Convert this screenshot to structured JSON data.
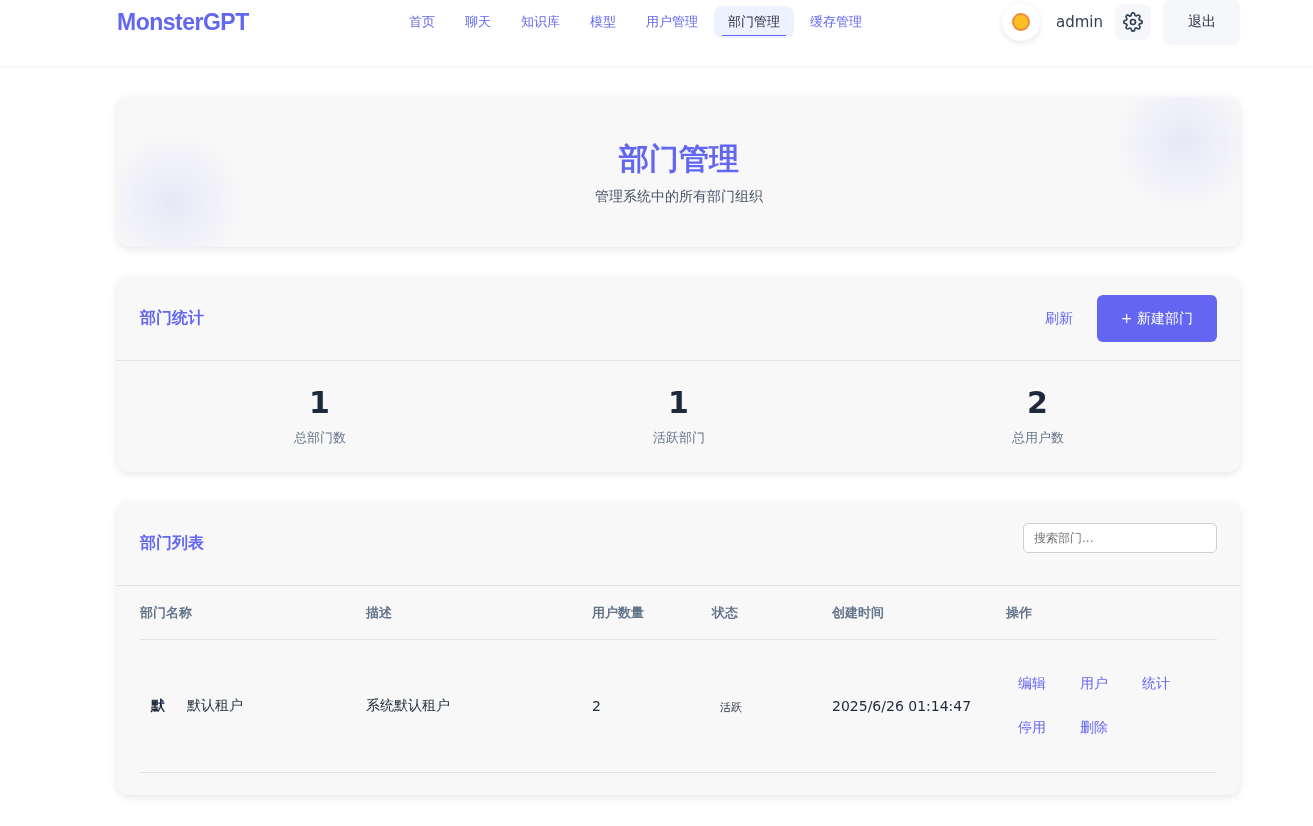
{
  "header": {
    "logo": "MonsterGPT",
    "nav": [
      {
        "label": "首页",
        "selected": false
      },
      {
        "label": "聊天",
        "selected": false
      },
      {
        "label": "知识库",
        "selected": false
      },
      {
        "label": "模型",
        "selected": false
      },
      {
        "label": "用户管理",
        "selected": false
      },
      {
        "label": "部门管理",
        "selected": true
      },
      {
        "label": "缓存管理",
        "selected": false
      }
    ],
    "user": "admin",
    "logout": "退出"
  },
  "hero": {
    "title": "部门管理",
    "subtitle": "管理系统中的所有部门组织"
  },
  "stats_card": {
    "title": "部门统计",
    "refresh": "刷新",
    "create": "+ 新建部门",
    "stats": [
      {
        "value": "1",
        "label": "总部门数"
      },
      {
        "value": "1",
        "label": "活跃部门"
      },
      {
        "value": "2",
        "label": "总用户数"
      }
    ]
  },
  "list_card": {
    "title": "部门列表",
    "search": {
      "placeholder": "搜索部门..."
    },
    "columns": [
      "部门名称",
      "描述",
      "用户数量",
      "状态",
      "创建时间",
      "操作"
    ],
    "rows": [
      {
        "avatar": "默",
        "name": "默认租户",
        "description": "系统默认租户",
        "users": "2",
        "status": "活跃",
        "created": "2025/6/26 01:14:47",
        "actions": [
          "编辑",
          "用户",
          "统计",
          "停用",
          "删除"
        ]
      }
    ]
  }
}
